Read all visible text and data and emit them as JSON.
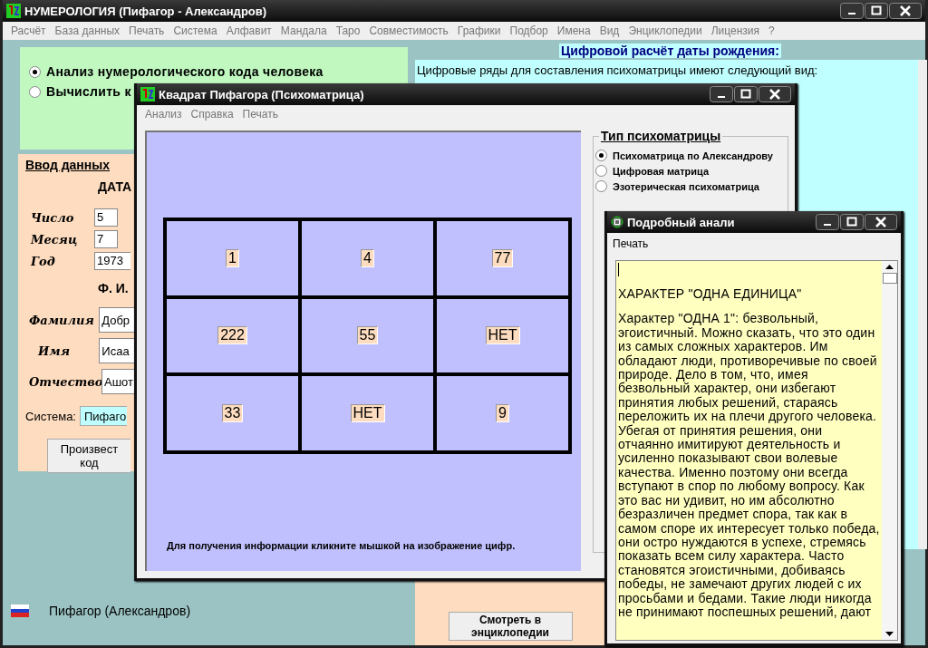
{
  "window": {
    "title": "НУМЕРОЛОГИЯ (Пифагор - Александров)",
    "menu": [
      "Расчёт",
      "База данных",
      "Печать",
      "Система",
      "Алфавит",
      "Мандала",
      "Таро",
      "Совместимость",
      "Графики",
      "Подбор",
      "Имена",
      "Вид",
      "Энциклопедии",
      "Лицензия",
      "?"
    ]
  },
  "mode_options": [
    {
      "label": "Анализ нумерологического кода человека",
      "selected": true
    },
    {
      "label": "Вычислить к",
      "selected": false
    }
  ],
  "input_panel": {
    "title": "Ввод данных",
    "date_heading": "ДАТА",
    "date_fields": [
      {
        "label": "Число",
        "value": "5"
      },
      {
        "label": "Месяц",
        "value": "7"
      },
      {
        "label": "Год",
        "value": "1973"
      }
    ],
    "name_heading": "Ф. И.",
    "name_fields": [
      {
        "label": "Фамилия",
        "value": "Добр"
      },
      {
        "label": "Имя",
        "value": "Исаа"
      },
      {
        "label": "Отчество",
        "value": "Ашот"
      }
    ],
    "system_label": "Система:",
    "system_value": "Пифаго",
    "button_lines": [
      "Произвест",
      "код"
    ]
  },
  "status": "Пифагор (Александров)",
  "calc_panel": {
    "title": "Цифровой расчёт даты рождения:",
    "text": "Цифровые ряды для составления психоматрицы имеют следующий вид:"
  },
  "encyclopedia_button": "Смотреть в энциклопедии",
  "matrix_window": {
    "title": "Квадрат Пифагора (Психоматрица)",
    "menu": [
      "Анализ",
      "Справка",
      "Печать"
    ],
    "cells": [
      "1",
      "4",
      "77",
      "222",
      "55",
      "НЕТ",
      "33",
      "НЕТ",
      "9"
    ],
    "hint": "Для получения информации кликните мышкой на изображение цифр.",
    "type_group": {
      "title": "Тип психоматрицы",
      "options": [
        {
          "label": "Психоматрица по Александрову",
          "selected": true
        },
        {
          "label": "Цифровая матрица",
          "selected": false
        },
        {
          "label": "Эзотерическая психоматрица",
          "selected": false
        }
      ]
    }
  },
  "detail_window": {
    "title": "Подробный анали",
    "menu": [
      "Печать"
    ],
    "heading": "ХАРАКТЕР \"ОДНА ЕДИНИЦА\"",
    "text": "Характер \"ОДНА 1\": безвольный, эгоистичный. Можно сказать, что это один из самых сложных характеров. Им обладают люди, противоречивые по своей природе. Дело в том, что, имея безвольный характер, они избегают принятия любых решений, стараясь переложить их на плечи другого человека. Убегая от принятия решения, они отчаянно имитируют деятельность и усиленно показывают свои волевые качества. Именно поэтому они всегда вступают в спор по любому вопросу. Как это вас ни удивит, но им абсолютно безразличен предмет спора, так как в самом споре их интересует только победа, они остро нуждаются в успехе, стремясь показать всем силу характера. Часто становятся эгоистичными, добиваясь победы, не замечают других людей с их просьбами и бедами. Такие люди никогда не принимают поспешных решений, дают"
  }
}
